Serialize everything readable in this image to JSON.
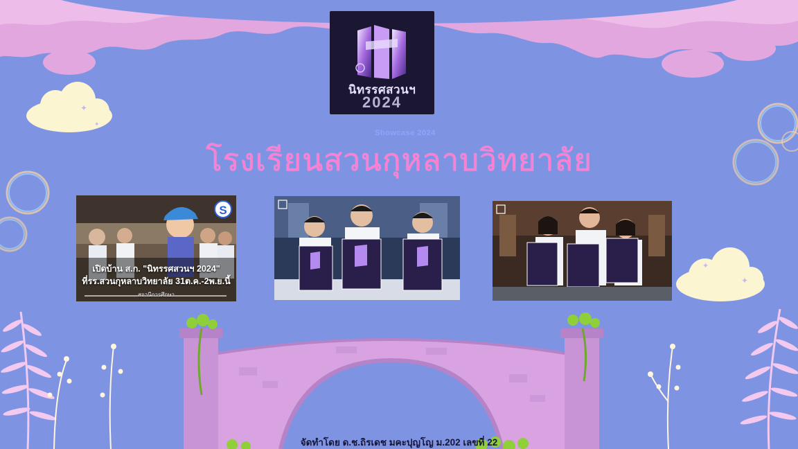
{
  "logo": {
    "name": "นิทรรศสวนฯ",
    "year": "2024"
  },
  "subtitle": "Showcase 2024",
  "title": "โรงเรียนสวนกุหลาบวิทยาลัย",
  "photos": [
    {
      "caption_line1": "เปิดบ้าน ส.ก. \"นิทรรศสวนฯ 2024\"",
      "caption_line2": "ที่รร.สวนกุหลาบวิทยาลัย 31ต.ค.-2พ.ย.นี้",
      "caption_source": "สถานีการศึกษา",
      "badge": "S"
    },
    {
      "badge": ""
    },
    {
      "badge": ""
    }
  ],
  "footer": "จัดทำโดย ด.ช.ถิรเดช มคะปุญโญ ม.202 เลขที่ 22",
  "colors": {
    "background": "#7f93e3",
    "title": "#ff7ed2",
    "pink_deco": "#e3a7e0",
    "bridge": "#d9a2e0"
  }
}
